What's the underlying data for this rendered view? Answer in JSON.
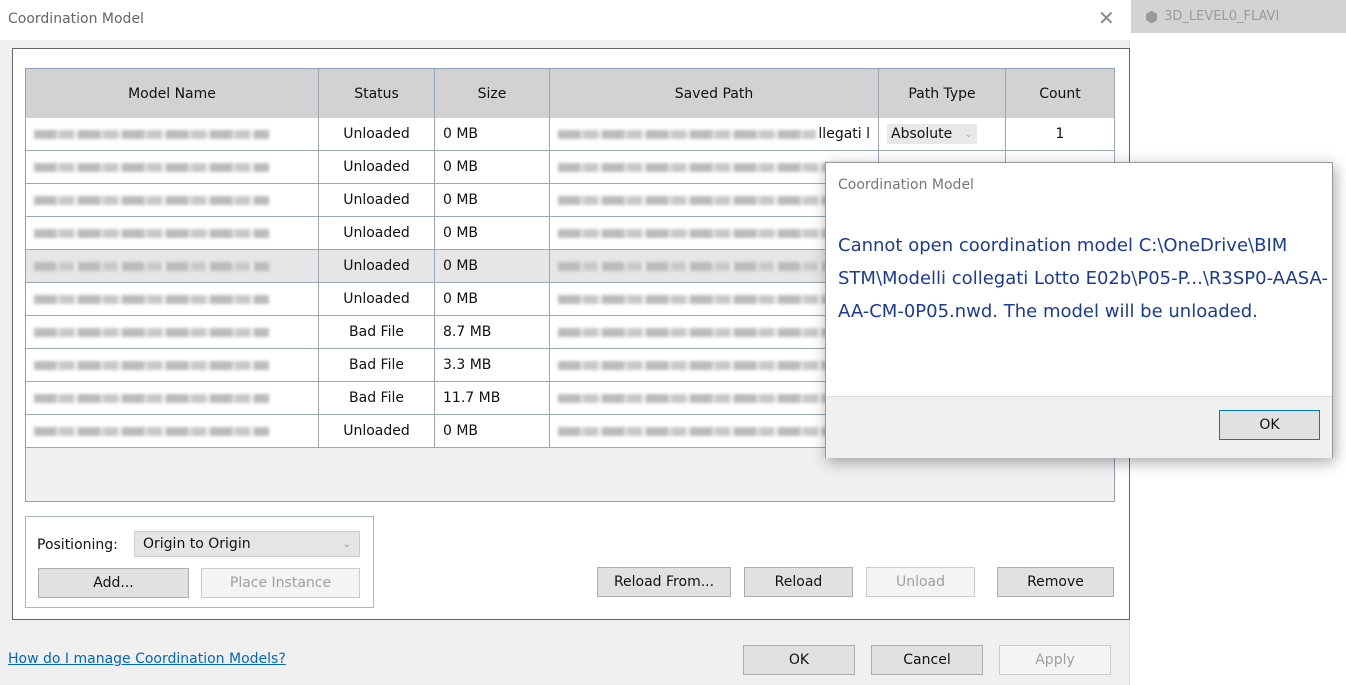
{
  "dialog": {
    "title": "Coordination Model",
    "close_icon": "close-icon"
  },
  "table": {
    "columns": [
      "Model Name",
      "Status",
      "Size",
      "Saved Path",
      "Path Type",
      "Count"
    ],
    "rows": [
      {
        "status": "Unloaded",
        "size": "0 MB",
        "path_tail": "llegati l",
        "path_type": "Absolute",
        "count": "1"
      },
      {
        "status": "Unloaded",
        "size": "0 MB"
      },
      {
        "status": "Unloaded",
        "size": "0 MB"
      },
      {
        "status": "Unloaded",
        "size": "0 MB"
      },
      {
        "status": "Unloaded",
        "size": "0 MB",
        "selected": true
      },
      {
        "status": "Unloaded",
        "size": "0 MB"
      },
      {
        "status": "Bad File",
        "size": "8.7 MB"
      },
      {
        "status": "Bad File",
        "size": "3.3 MB"
      },
      {
        "status": "Bad File",
        "size": "11.7 MB"
      },
      {
        "status": "Unloaded",
        "size": "0 MB"
      }
    ]
  },
  "positioning": {
    "label": "Positioning:",
    "value": "Origin to Origin"
  },
  "buttons": {
    "add": "Add...",
    "place_instance": "Place Instance",
    "reload_from": "Reload From...",
    "reload": "Reload",
    "unload": "Unload",
    "remove": "Remove",
    "ok": "OK",
    "cancel": "Cancel",
    "apply": "Apply"
  },
  "help_link": "How do I manage Coordination Models?",
  "view_tab": {
    "label": "3D_LEVEL0_FLAVI",
    "icon": "3d-view-icon"
  },
  "popup": {
    "title": "Coordination Model",
    "message": "Cannot open coordination model C:\\OneDrive\\BIM STM\\Modelli collegati Lotto E02b\\P05-P...\\R3SP0-AASA-AA-CM-0P05.nwd. The model will be unloaded.",
    "ok": "OK",
    "message_color": "#1b3a9e"
  }
}
